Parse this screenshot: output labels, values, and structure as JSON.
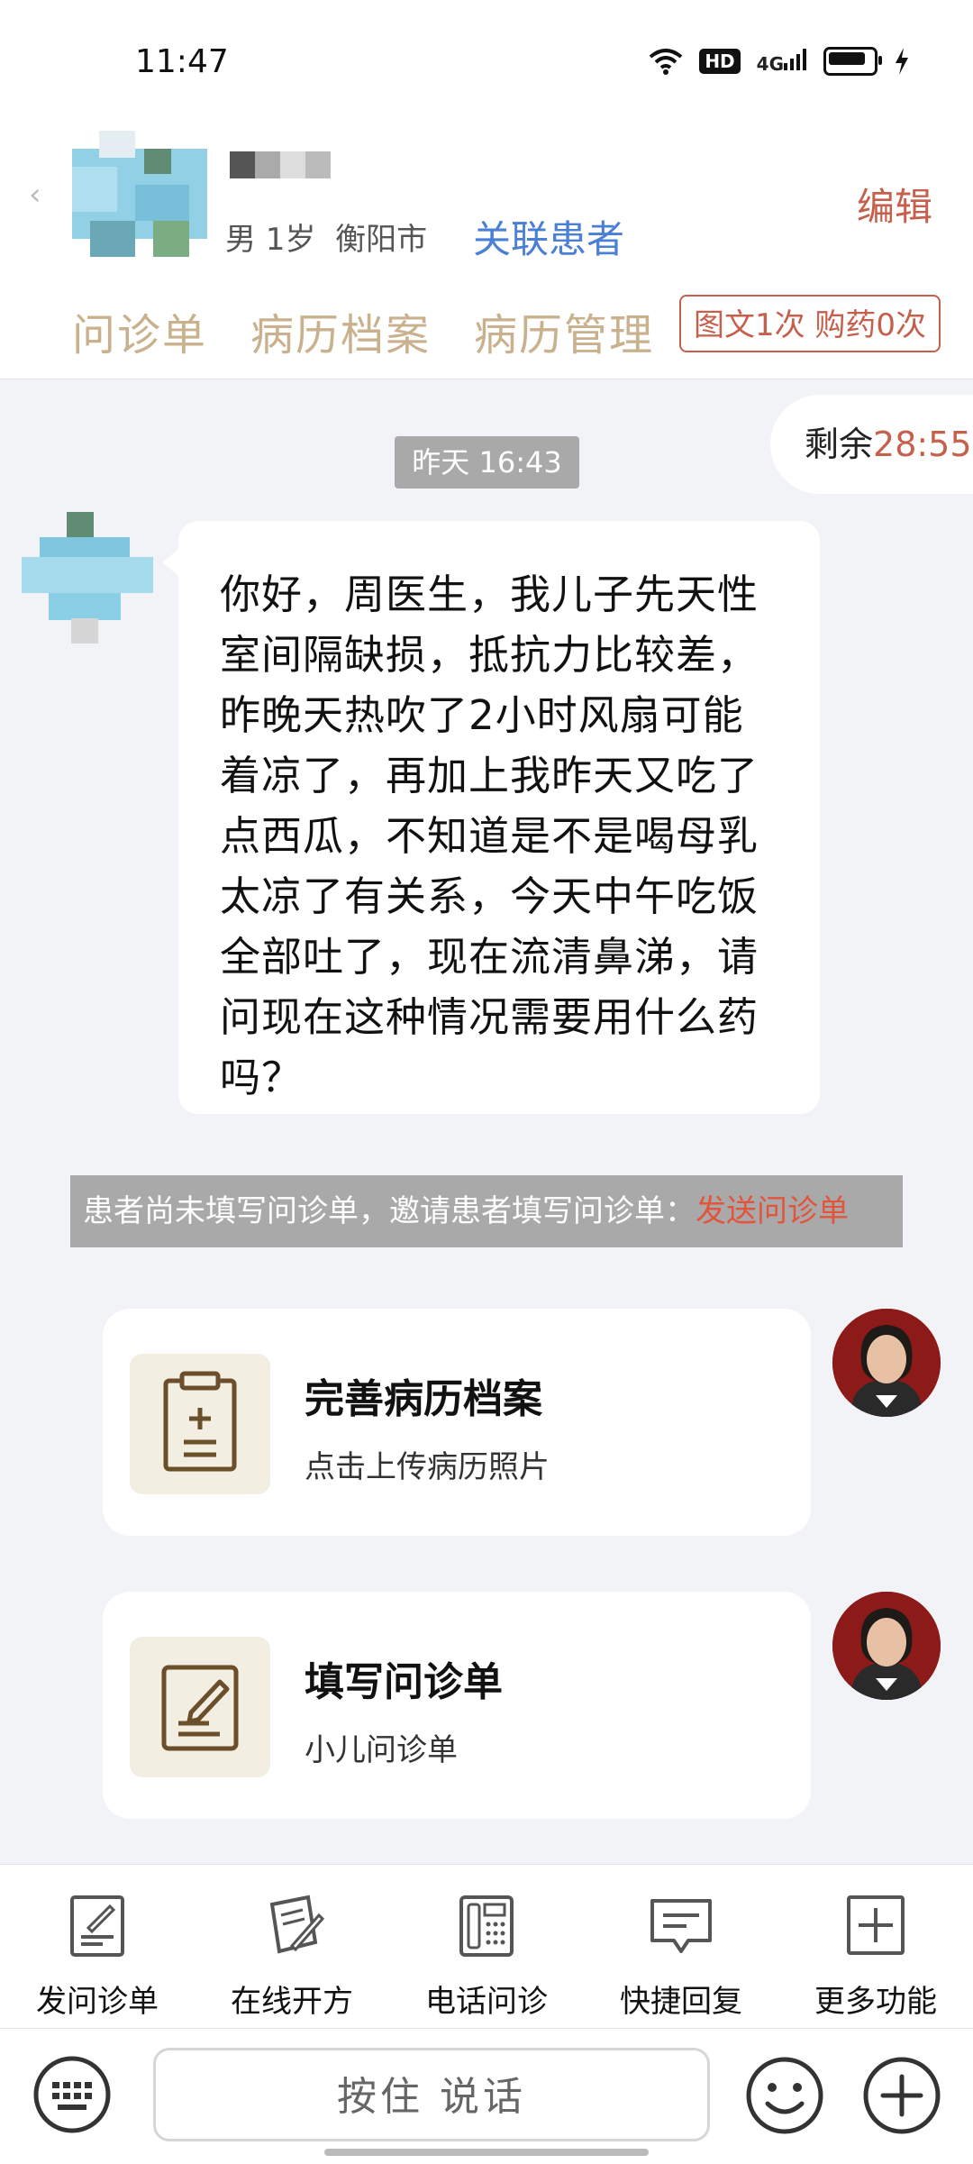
{
  "status_bar": {
    "time": "11:47",
    "hd": "HD",
    "network": "4G"
  },
  "header": {
    "gender_age": "男 1岁",
    "city": "衡阳市",
    "link_patient": "关联患者",
    "edit": "编辑"
  },
  "tabs": [
    "问诊单",
    "病历档案",
    "病历管理"
  ],
  "quota": "图文1次 购药0次",
  "remaining": {
    "label": "剩余",
    "countdown": "28:55"
  },
  "timestamp": "昨天 16:43",
  "patient_message": {
    "lines": [
      "你好，周医生，我儿子先天性",
      "室间隔缺损，抵抗力比较差，",
      "昨晚天热吹了2小时风扇可能",
      "着凉了，再加上我昨天又吃了",
      "点西瓜，不知道是不是喝母乳",
      "太凉了有关系，今天中午吃饭",
      "全部吐了，现在流清鼻涕，请",
      "问现在这种情况需要用什么药",
      "吗？"
    ]
  },
  "notice": {
    "text": "患者尚未填写问诊单，邀请患者填写问诊单：",
    "action": "发送问诊单"
  },
  "cards": [
    {
      "title": "完善病历档案",
      "subtitle": "点击上传病历照片",
      "icon": "clipboard-plus-icon"
    },
    {
      "title": "填写问诊单",
      "subtitle": "小儿问诊单",
      "icon": "form-edit-icon"
    }
  ],
  "toolbar": [
    {
      "label": "发问诊单",
      "icon": "send-form-icon"
    },
    {
      "label": "在线开方",
      "icon": "prescription-icon"
    },
    {
      "label": "电话问诊",
      "icon": "phone-icon"
    },
    {
      "label": "快捷回复",
      "icon": "quick-reply-icon"
    },
    {
      "label": "更多功能",
      "icon": "more-icon"
    }
  ],
  "input": {
    "voice_label": "按住 说话"
  },
  "colors": {
    "accent": "#c4604b",
    "tab": "#c9b18e",
    "link": "#4a7fd6"
  }
}
